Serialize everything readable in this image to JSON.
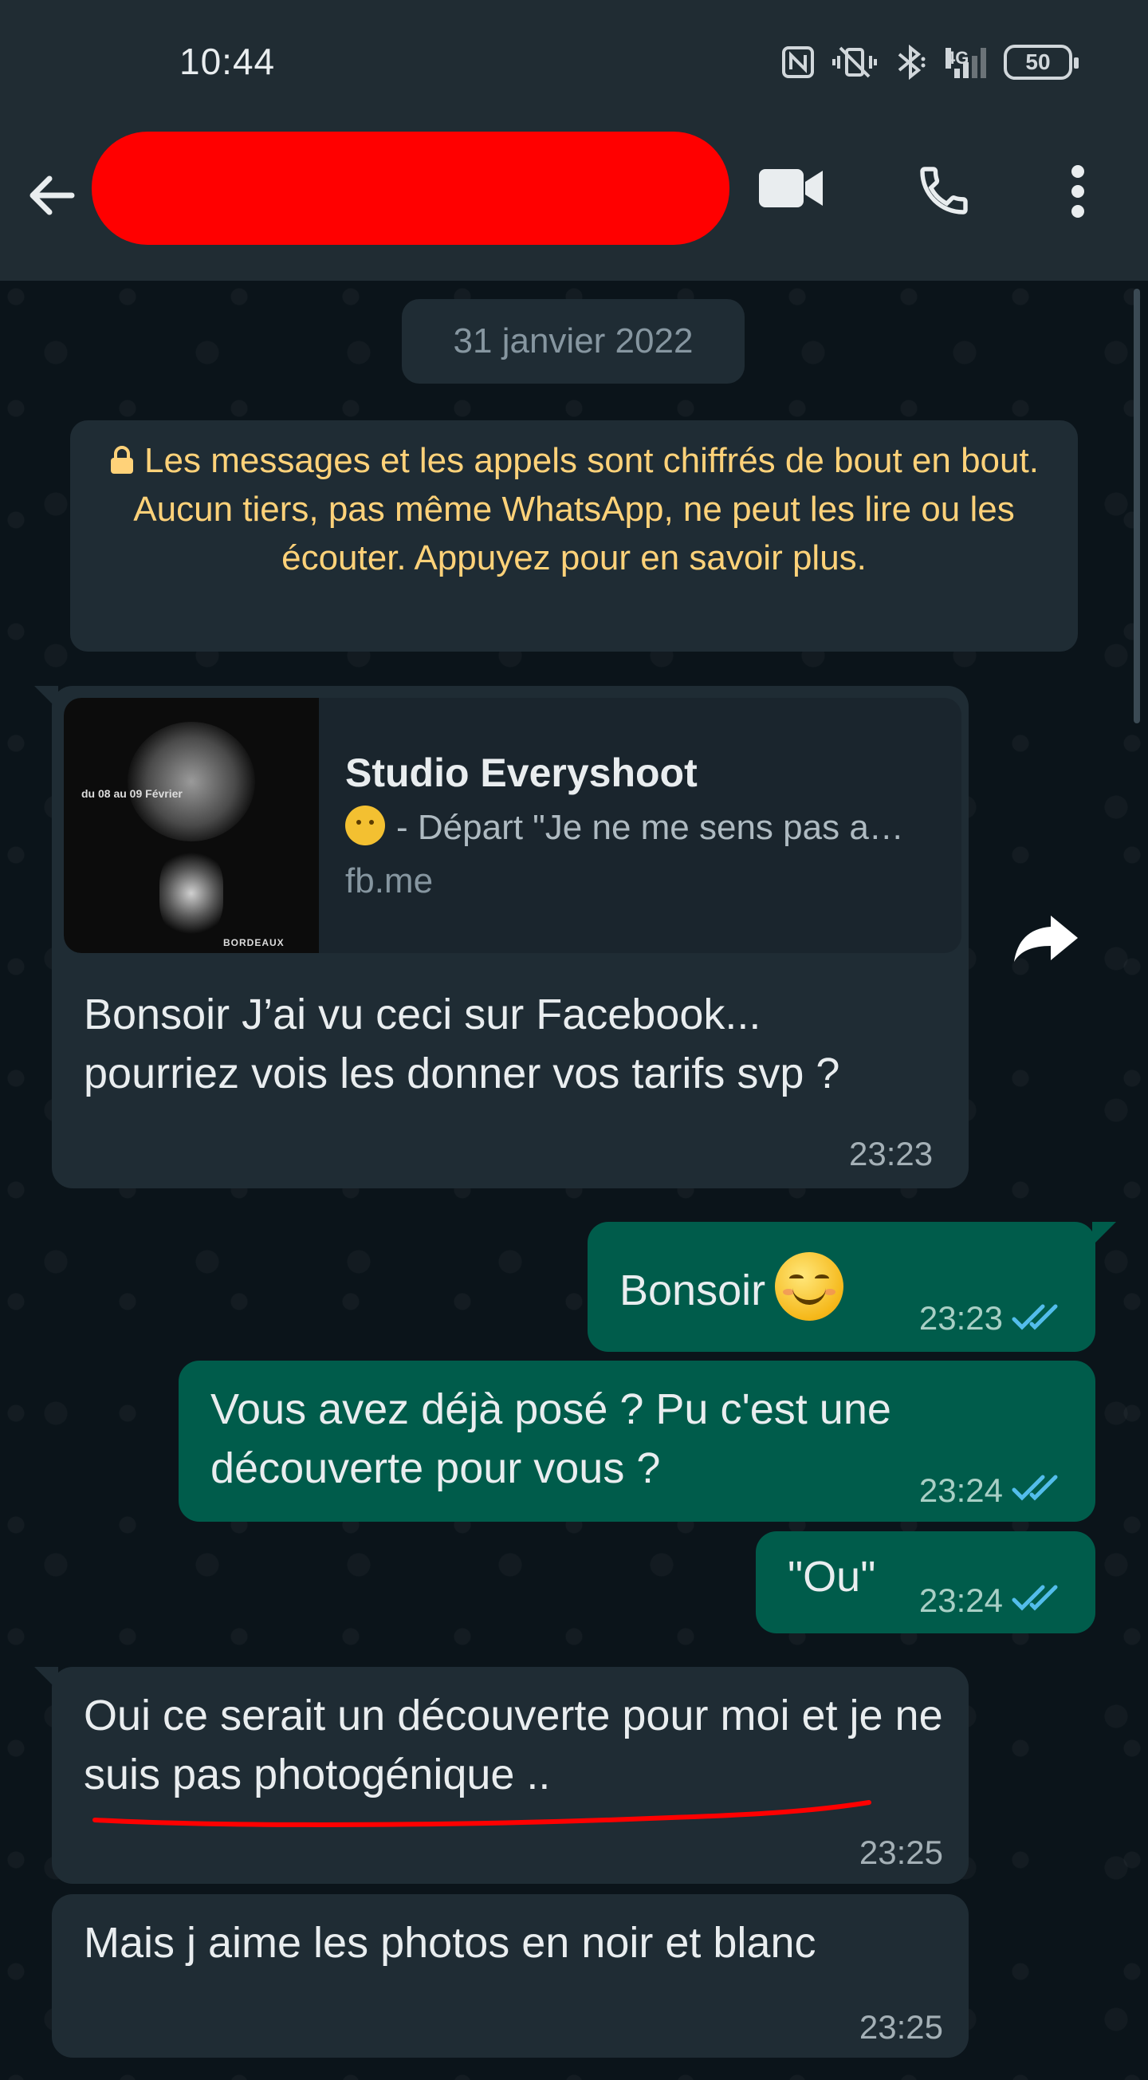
{
  "status_bar": {
    "time": "10:44",
    "network": "4G",
    "battery": "50"
  },
  "header": {
    "contact_name_redacted": true
  },
  "chat": {
    "date_separator": "31 janvier 2022",
    "encryption_notice": "Les messages et les appels sont chiffrés de bout en bout. Aucun tiers, pas même WhatsApp, ne peut les lire ou les écouter. Appuyez pour en savoir plus.",
    "messages": [
      {
        "direction": "incoming",
        "link_preview": {
          "title": "Studio Everyshoot",
          "description": "- Départ \"Je ne me sens pas a…",
          "domain": "fb.me",
          "thumb_top_text": "du 08 au 09 Février",
          "thumb_bottom_text": "BORDEAUX"
        },
        "text": "Bonsoir J’ai vu ceci sur Facebook... pourriez vois les donner vos tarifs svp ?",
        "time": "23:23"
      },
      {
        "direction": "outgoing",
        "text": "Bonsoir",
        "time": "23:23",
        "status": "read"
      },
      {
        "direction": "outgoing",
        "text": "Vous avez déjà posé ? Pu c'est une découverte pour vous ?",
        "time": "23:24",
        "status": "read"
      },
      {
        "direction": "outgoing",
        "text": "\"Ou\"",
        "time": "23:24",
        "status": "read"
      },
      {
        "direction": "incoming",
        "text": "Oui ce serait un découverte pour moi et je ne suis pas photogénique ..",
        "time": "23:25",
        "annotation": "red-underline"
      },
      {
        "direction": "incoming",
        "text": "Mais j aime les photos en noir et blanc",
        "time": "23:25"
      }
    ]
  },
  "colors": {
    "header_bg": "#202c33",
    "chat_bg": "#0b141a",
    "incoming_bubble": "#1f2c34",
    "outgoing_bubble": "#005c4b",
    "notice_text": "#ffd279",
    "read_ticks": "#53bdeb",
    "redaction": "#ff0000"
  }
}
